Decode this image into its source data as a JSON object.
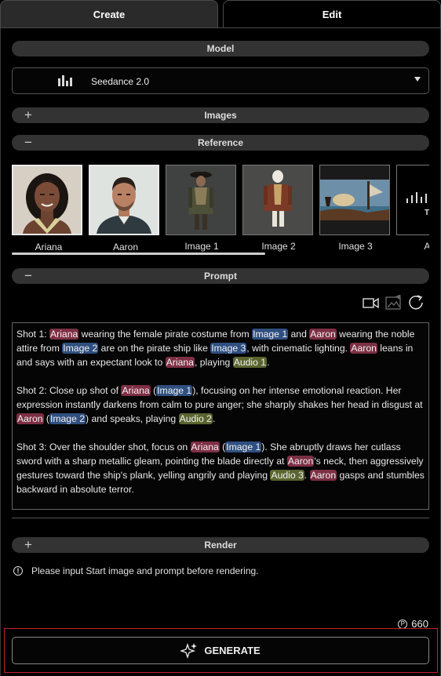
{
  "tabs": {
    "create": "Create",
    "edit": "Edit"
  },
  "sections": {
    "model": "Model",
    "images": "Images",
    "reference": "Reference",
    "prompt": "Prompt",
    "render": "Render"
  },
  "symbols": {
    "plus": "+",
    "minus": "−"
  },
  "model_select": {
    "value": "Seedance 2.0"
  },
  "references": [
    {
      "label": "Ariana"
    },
    {
      "label": "Aaron"
    },
    {
      "label": "Image 1"
    },
    {
      "label": "Image 2"
    },
    {
      "label": "Image 3"
    },
    {
      "label": "Aud",
      "thumb_text": "T"
    }
  ],
  "prompt": {
    "shot1": {
      "a": "Shot 1: ",
      "ariana": "Ariana",
      "b": " wearing the female pirate costume from ",
      "img1": "Image 1",
      "c": " and ",
      "aaron": "Aaron",
      "d": " wearing the noble attire from ",
      "img2": "Image 2",
      "e": " are on the pirate ship like ",
      "img3": "Image 3",
      "f": ", with cinematic lighting. ",
      "aaron2": "Aaron",
      "g": " leans in and says with an expectant look to ",
      "ariana2": "Ariana",
      "h": ", playing ",
      "audio1": "Audio 1",
      "i": "."
    },
    "shot2": {
      "a": "Shot 2: Close up shot of ",
      "ariana": "Ariana",
      "b": " (",
      "img1": "Image 1",
      "c": "), focusing on her intense emotional reaction. Her expression instantly darkens from calm to pure anger; she sharply shakes her head in disgust at ",
      "aaron": "Aaron",
      "d": " (",
      "img2": "Image 2",
      "e": ") and speaks, playing ",
      "audio2": "Audio 2",
      "f": "."
    },
    "shot3": {
      "a": "Shot 3: Over the shoulder shot, focus on ",
      "ariana": "Ariana",
      "b": " (",
      "img1": "Image 1",
      "c": "). She abruptly draws her cutlass sword with a sharp metallic gleam, pointing the blade directly at ",
      "aaron": "Aaron",
      "d": "'s neck, then aggressively gestures toward the ship's plank, yelling angrily and playing ",
      "audio3": "Audio 3",
      "e": ". ",
      "aaron2": "Aaron",
      "f": " gasps and stumbles backward in absolute terror."
    }
  },
  "warning": "Please input Start image and prompt before rendering.",
  "credits": {
    "value": "660",
    "icon_text": "P"
  },
  "generate": "GENERATE",
  "colors": {
    "person_tag": "#7d2f44",
    "image_tag": "#2f4f80",
    "audio_tag": "#5a6530",
    "focus_outline": "#c0202a"
  }
}
